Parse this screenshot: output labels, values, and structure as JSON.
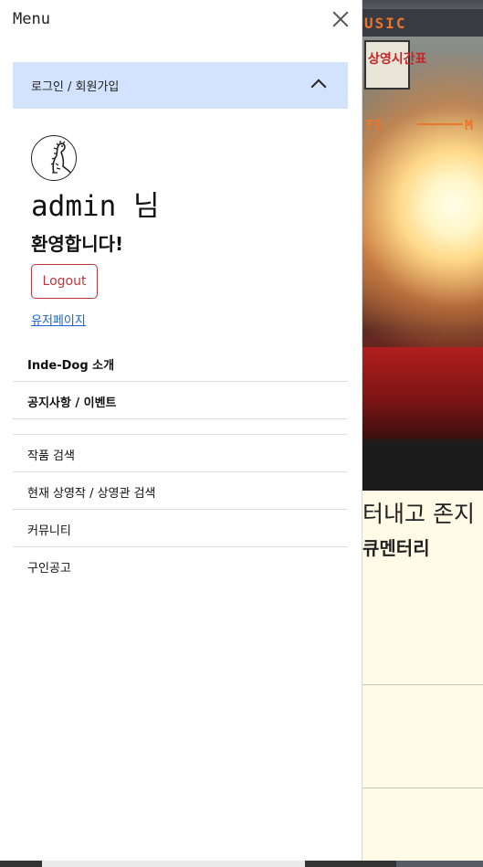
{
  "drawer": {
    "title": "Menu",
    "close_icon": "close-icon",
    "login_section": {
      "label": "로그인 / 회원가입",
      "icon": "chevron-up-icon"
    },
    "user": {
      "avatar_icon": "dinosaur-avatar-icon",
      "name": "admin 님",
      "welcome": "환영합니다!",
      "logout_label": "Logout",
      "mypage_label": "유저페이지"
    },
    "menu_primary": [
      {
        "label": "Inde-Dog 소개"
      },
      {
        "label": "공지사항 / 이벤트"
      }
    ],
    "menu_secondary": [
      {
        "label": "작품 검색"
      },
      {
        "label": "현재 상영작 / 상영관 검색"
      },
      {
        "label": "커뮤니티"
      },
      {
        "label": "구인공고"
      }
    ]
  },
  "background": {
    "hero_band_top": "USIC",
    "hero_sign": "상영시간표",
    "hero_band_mid_left": "FE",
    "hero_band_mid_right": "M",
    "headline_fragment": "터내고 존지",
    "subline_fragment": "큐멘터리"
  },
  "colors": {
    "login_bar_bg": "#d3e3fd",
    "logout_accent": "#c2343a",
    "link": "#1a63d6",
    "page_bg": "#fffbe6"
  }
}
